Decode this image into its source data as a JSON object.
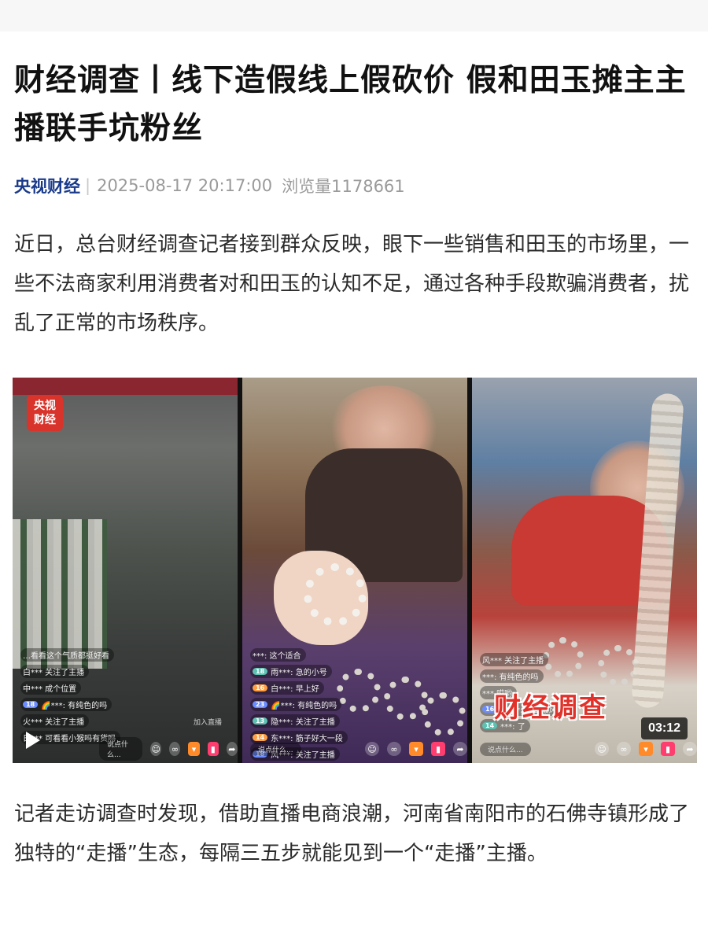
{
  "article": {
    "title": "财经调查丨线下造假线上假砍价 假和田玉摊主主播联手坑粉丝",
    "source": "央视财经",
    "separator": "|",
    "datetime": "2025-08-17 20:17:00",
    "views_label": "浏览量",
    "views_count": "1178661",
    "paragraphs": [
      "近日，总台财经调查记者接到群众反映，眼下一些销售和田玉的市场里，一些不法商家利用消费者对和田玉的认知不足，通过各种手段欺骗消费者，扰乱了正常的市场秩序。",
      "记者走访调查时发现，借助直播电商浪潮，河南省南阳市的石佛寺镇形成了独特的“走播”生态，每隔三五步就能见到一个“走播”主播。"
    ]
  },
  "video": {
    "logo_line1": "央视",
    "logo_line2": "财经",
    "overlay_caption": "财经调查",
    "duration": "03:12",
    "panel_a": {
      "comments": [
        {
          "level": "",
          "text": "…看看这个气质都挺好看"
        },
        {
          "level": "",
          "text": "白*** 关注了主播"
        },
        {
          "level": "",
          "text": "中*** 成个位置"
        },
        {
          "level": "18",
          "text": "🌈***: 有纯色的吗"
        },
        {
          "level": "",
          "text": "火*** 关注了主播"
        },
        {
          "level": "",
          "text": "日*** 可看看小猴吗有货吗"
        }
      ],
      "join_text": "加入直播",
      "say_placeholder": "说点什么..."
    },
    "panel_b": {
      "comments": [
        {
          "level": "",
          "text": "***: 这个适合"
        },
        {
          "level": "18",
          "text": "雨***: 急的小号"
        },
        {
          "level": "16",
          "text": "白***: 早上好"
        },
        {
          "level": "23",
          "text": "🌈***: 有纯色的吗"
        },
        {
          "level": "13",
          "text": "隐***: 关注了主播"
        },
        {
          "level": "14",
          "text": "东***: 筋子好大一段"
        },
        {
          "level": "18",
          "text": "风***: 关注了主播"
        },
        {
          "level": "13",
          "text": "巴***: 赤了"
        }
      ],
      "say_placeholder": "说点什么..."
    },
    "panel_c": {
      "comments": [
        {
          "level": "",
          "text": "风*** 关注了主播"
        },
        {
          "level": "",
          "text": "***: 有纯色的吗"
        },
        {
          "level": "",
          "text": "*** 哎哟"
        },
        {
          "level": "16",
          "text": "丢***: 写日报风格"
        },
        {
          "level": "14",
          "text": "***: 了"
        }
      ],
      "say_placeholder": "说点什么..."
    }
  }
}
